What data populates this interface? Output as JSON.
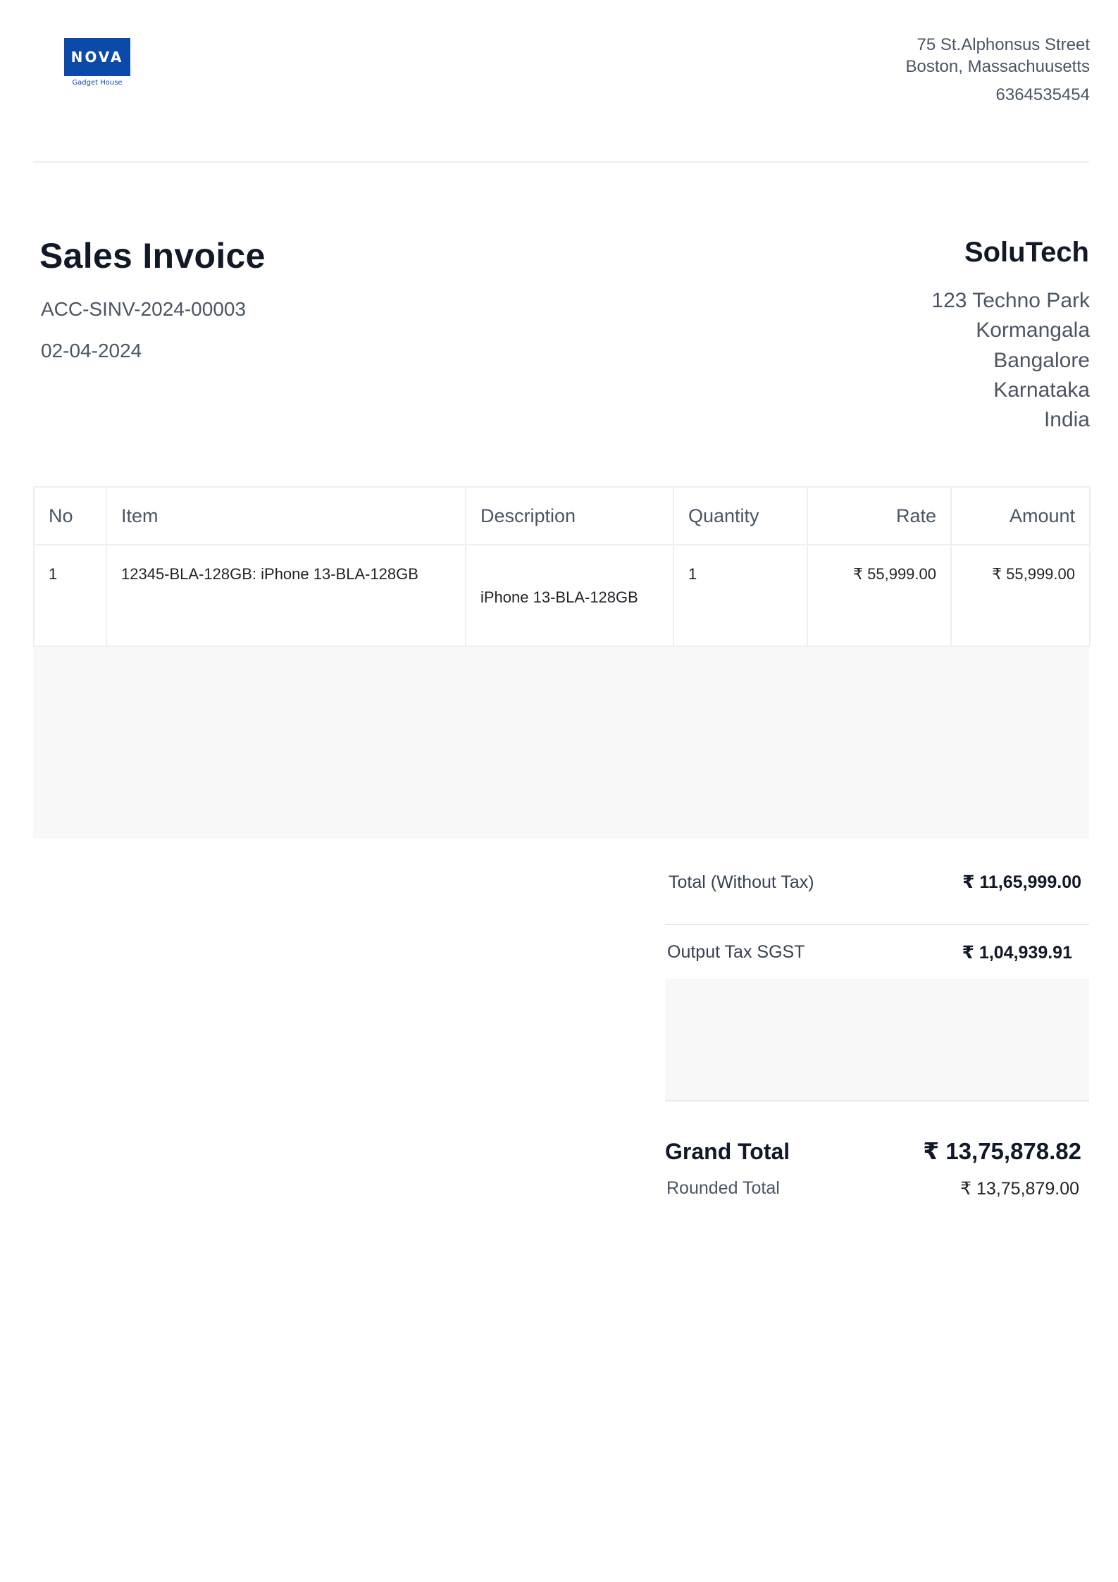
{
  "company": {
    "logo_text": "NOVA",
    "logo_subtext": "Gadget House",
    "brand_color": "#0b4aa8",
    "address_line1": "75 St.Alphonsus Street",
    "address_line2": "Boston, Massachuusetts",
    "phone": "6364535454"
  },
  "invoice": {
    "title": "Sales Invoice",
    "number": "ACC-SINV-2024-00003",
    "date": "02-04-2024"
  },
  "customer": {
    "name": "SoluTech",
    "address": [
      "123 Techno Park",
      "Kormangala",
      "Bangalore",
      "Karnataka",
      "India"
    ]
  },
  "items_table": {
    "headers": {
      "no": "No",
      "item": "Item",
      "description": "Description",
      "quantity": "Quantity",
      "rate": "Rate",
      "amount": "Amount"
    },
    "rows": [
      {
        "no": "1",
        "item": "12345-BLA-128GB: iPhone 13-BLA-128GB",
        "description": "iPhone 13-BLA-128GB",
        "quantity": "1",
        "rate": "₹ 55,999.00",
        "amount": "₹ 55,999.00"
      }
    ]
  },
  "totals": {
    "net_label": "Total (Without Tax)",
    "net_value": "₹ 11,65,999.00",
    "tax_label": "Output Tax SGST",
    "tax_value": "₹ 1,04,939.91",
    "grand_label": "Grand Total",
    "grand_value": "₹ 13,75,878.82",
    "rounded_label": "Rounded Total",
    "rounded_value": "₹ 13,75,879.00"
  }
}
